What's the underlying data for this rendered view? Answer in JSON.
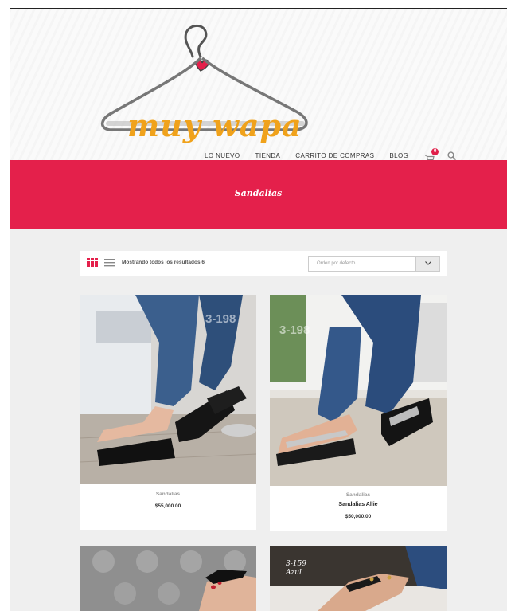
{
  "brand": {
    "logo_text": "muy wapa"
  },
  "nav": {
    "items": [
      "LO NUEVO",
      "TIENDA",
      "CARRITO DE COMPRAS",
      "BLOG"
    ],
    "cart_count": "0"
  },
  "hero": {
    "title": "Sandalias"
  },
  "toolbar": {
    "result_count": "Mostrando todos los resultados 6",
    "orderby_selected": "Orden por defecto"
  },
  "products": [
    {
      "category": "Sandalias",
      "name": "",
      "price": "$55,000.00",
      "watermark": "3-198"
    },
    {
      "category": "Sandalias",
      "name": "Sandalias Allie",
      "price": "$50,000.00",
      "watermark": "3-198"
    },
    {
      "category": "",
      "name": "",
      "price": "",
      "watermark": ""
    },
    {
      "category": "",
      "name": "",
      "price": "",
      "watermark": "",
      "code_line1": "3-159",
      "code_line2": "Azul"
    }
  ],
  "colors": {
    "accent": "#e4204b",
    "logo_orange": "#f0a21b",
    "content_bg": "#efefef"
  }
}
